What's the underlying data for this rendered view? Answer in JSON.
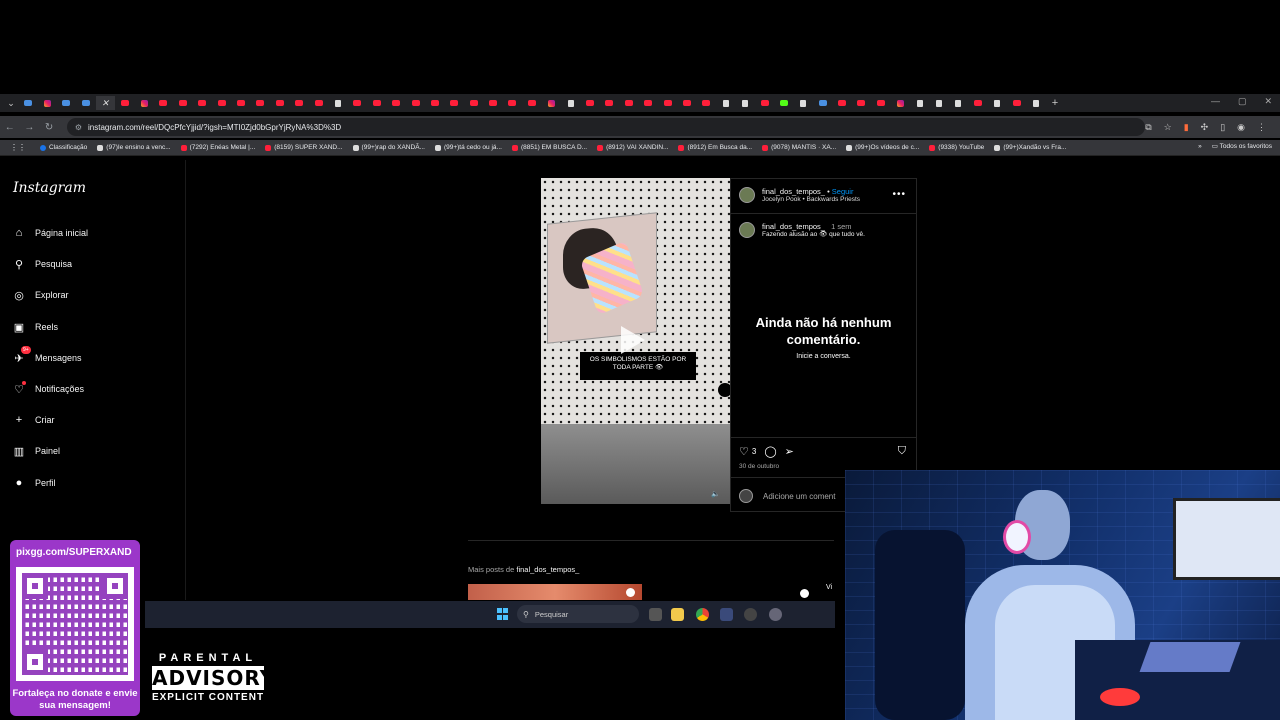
{
  "browser": {
    "url": "instagram.com/reel/DQcPfcYjjid/?igsh=MTI0Zjd0bGprYjRyNA%3D%3D",
    "bookmarks": [
      {
        "label": "Classificação",
        "kind": "cl"
      },
      {
        "label": "(97)Ie ensino a venc...",
        "kind": "tt"
      },
      {
        "label": "(7292) Enéas Metal |...",
        "kind": "yt"
      },
      {
        "label": "(8159) SUPER XAND...",
        "kind": "yt"
      },
      {
        "label": "(99+)rap do XANDÃ...",
        "kind": "tt"
      },
      {
        "label": "(99+)tá cedo ou já...",
        "kind": "tt"
      },
      {
        "label": "(8851) EM BUSCA D...",
        "kind": "yt"
      },
      {
        "label": "(8912) VAI XANDIN...",
        "kind": "yt"
      },
      {
        "label": "(8912) Em Busca da...",
        "kind": "yt"
      },
      {
        "label": "(9078) MANTIS · XA...",
        "kind": "yt"
      },
      {
        "label": "(99+)Os vídeos de c...",
        "kind": "tt"
      },
      {
        "label": "(9338) YouTube",
        "kind": "yt"
      },
      {
        "label": "(99+)Xandão vs Fra...",
        "kind": "tt"
      }
    ],
    "all_bookmarks_label": "Todos os favoritos"
  },
  "instagram": {
    "logo": "Instagram",
    "nav": [
      {
        "label": "Página inicial",
        "icon": "home-icon",
        "glyph": "⌂"
      },
      {
        "label": "Pesquisa",
        "icon": "search-icon",
        "glyph": "⚲"
      },
      {
        "label": "Explorar",
        "icon": "compass-icon",
        "glyph": "◎"
      },
      {
        "label": "Reels",
        "icon": "reels-icon",
        "glyph": "▣"
      },
      {
        "label": "Mensagens",
        "icon": "messenger-icon",
        "glyph": "✈"
      },
      {
        "label": "Notificações",
        "icon": "heart-icon",
        "glyph": "♡"
      },
      {
        "label": "Criar",
        "icon": "plus-icon",
        "glyph": "+"
      },
      {
        "label": "Painel",
        "icon": "dashboard-icon",
        "glyph": "▥"
      },
      {
        "label": "Perfil",
        "icon": "profile-avatar",
        "glyph": "●"
      }
    ],
    "messages_badge": "9+"
  },
  "post": {
    "username": "final_dos_tempos_",
    "follow": "Seguir",
    "audio": "Jocelyn Pook • Backwards Priests",
    "caption_user": "final_dos_tempos_",
    "caption_time": "1 sem",
    "caption_text": "Fazendo alusão ao 👁 que tudo vê.",
    "video_text": "OS SIMBOLISMOS ESTÃO POR TODA PARTE 👁",
    "empty_title": "Ainda não há nenhum comentário.",
    "empty_sub": "Inicie a conversa.",
    "likes": "3",
    "date": "30 de outubro",
    "add_comment_placeholder": "Adicione um coment",
    "more_posts_prefix": "Mais posts de",
    "more_posts_user": "final_dos_tempos_",
    "vi_label": "Vi"
  },
  "taskbar": {
    "search_placeholder": "Pesquisar"
  },
  "overlay": {
    "qr_url": "pixgg.com/SUPERXAND",
    "qr_text": "Fortaleça no donate e envie sua mensagem!",
    "advisory_top": "PARENTAL",
    "advisory_mid": "ADVISORY",
    "advisory_bot": "EXPLICIT CONTENT"
  },
  "colors": {
    "accent": "#0095f6",
    "badge": "#ff3040",
    "qr_card": "#9b37c9"
  }
}
